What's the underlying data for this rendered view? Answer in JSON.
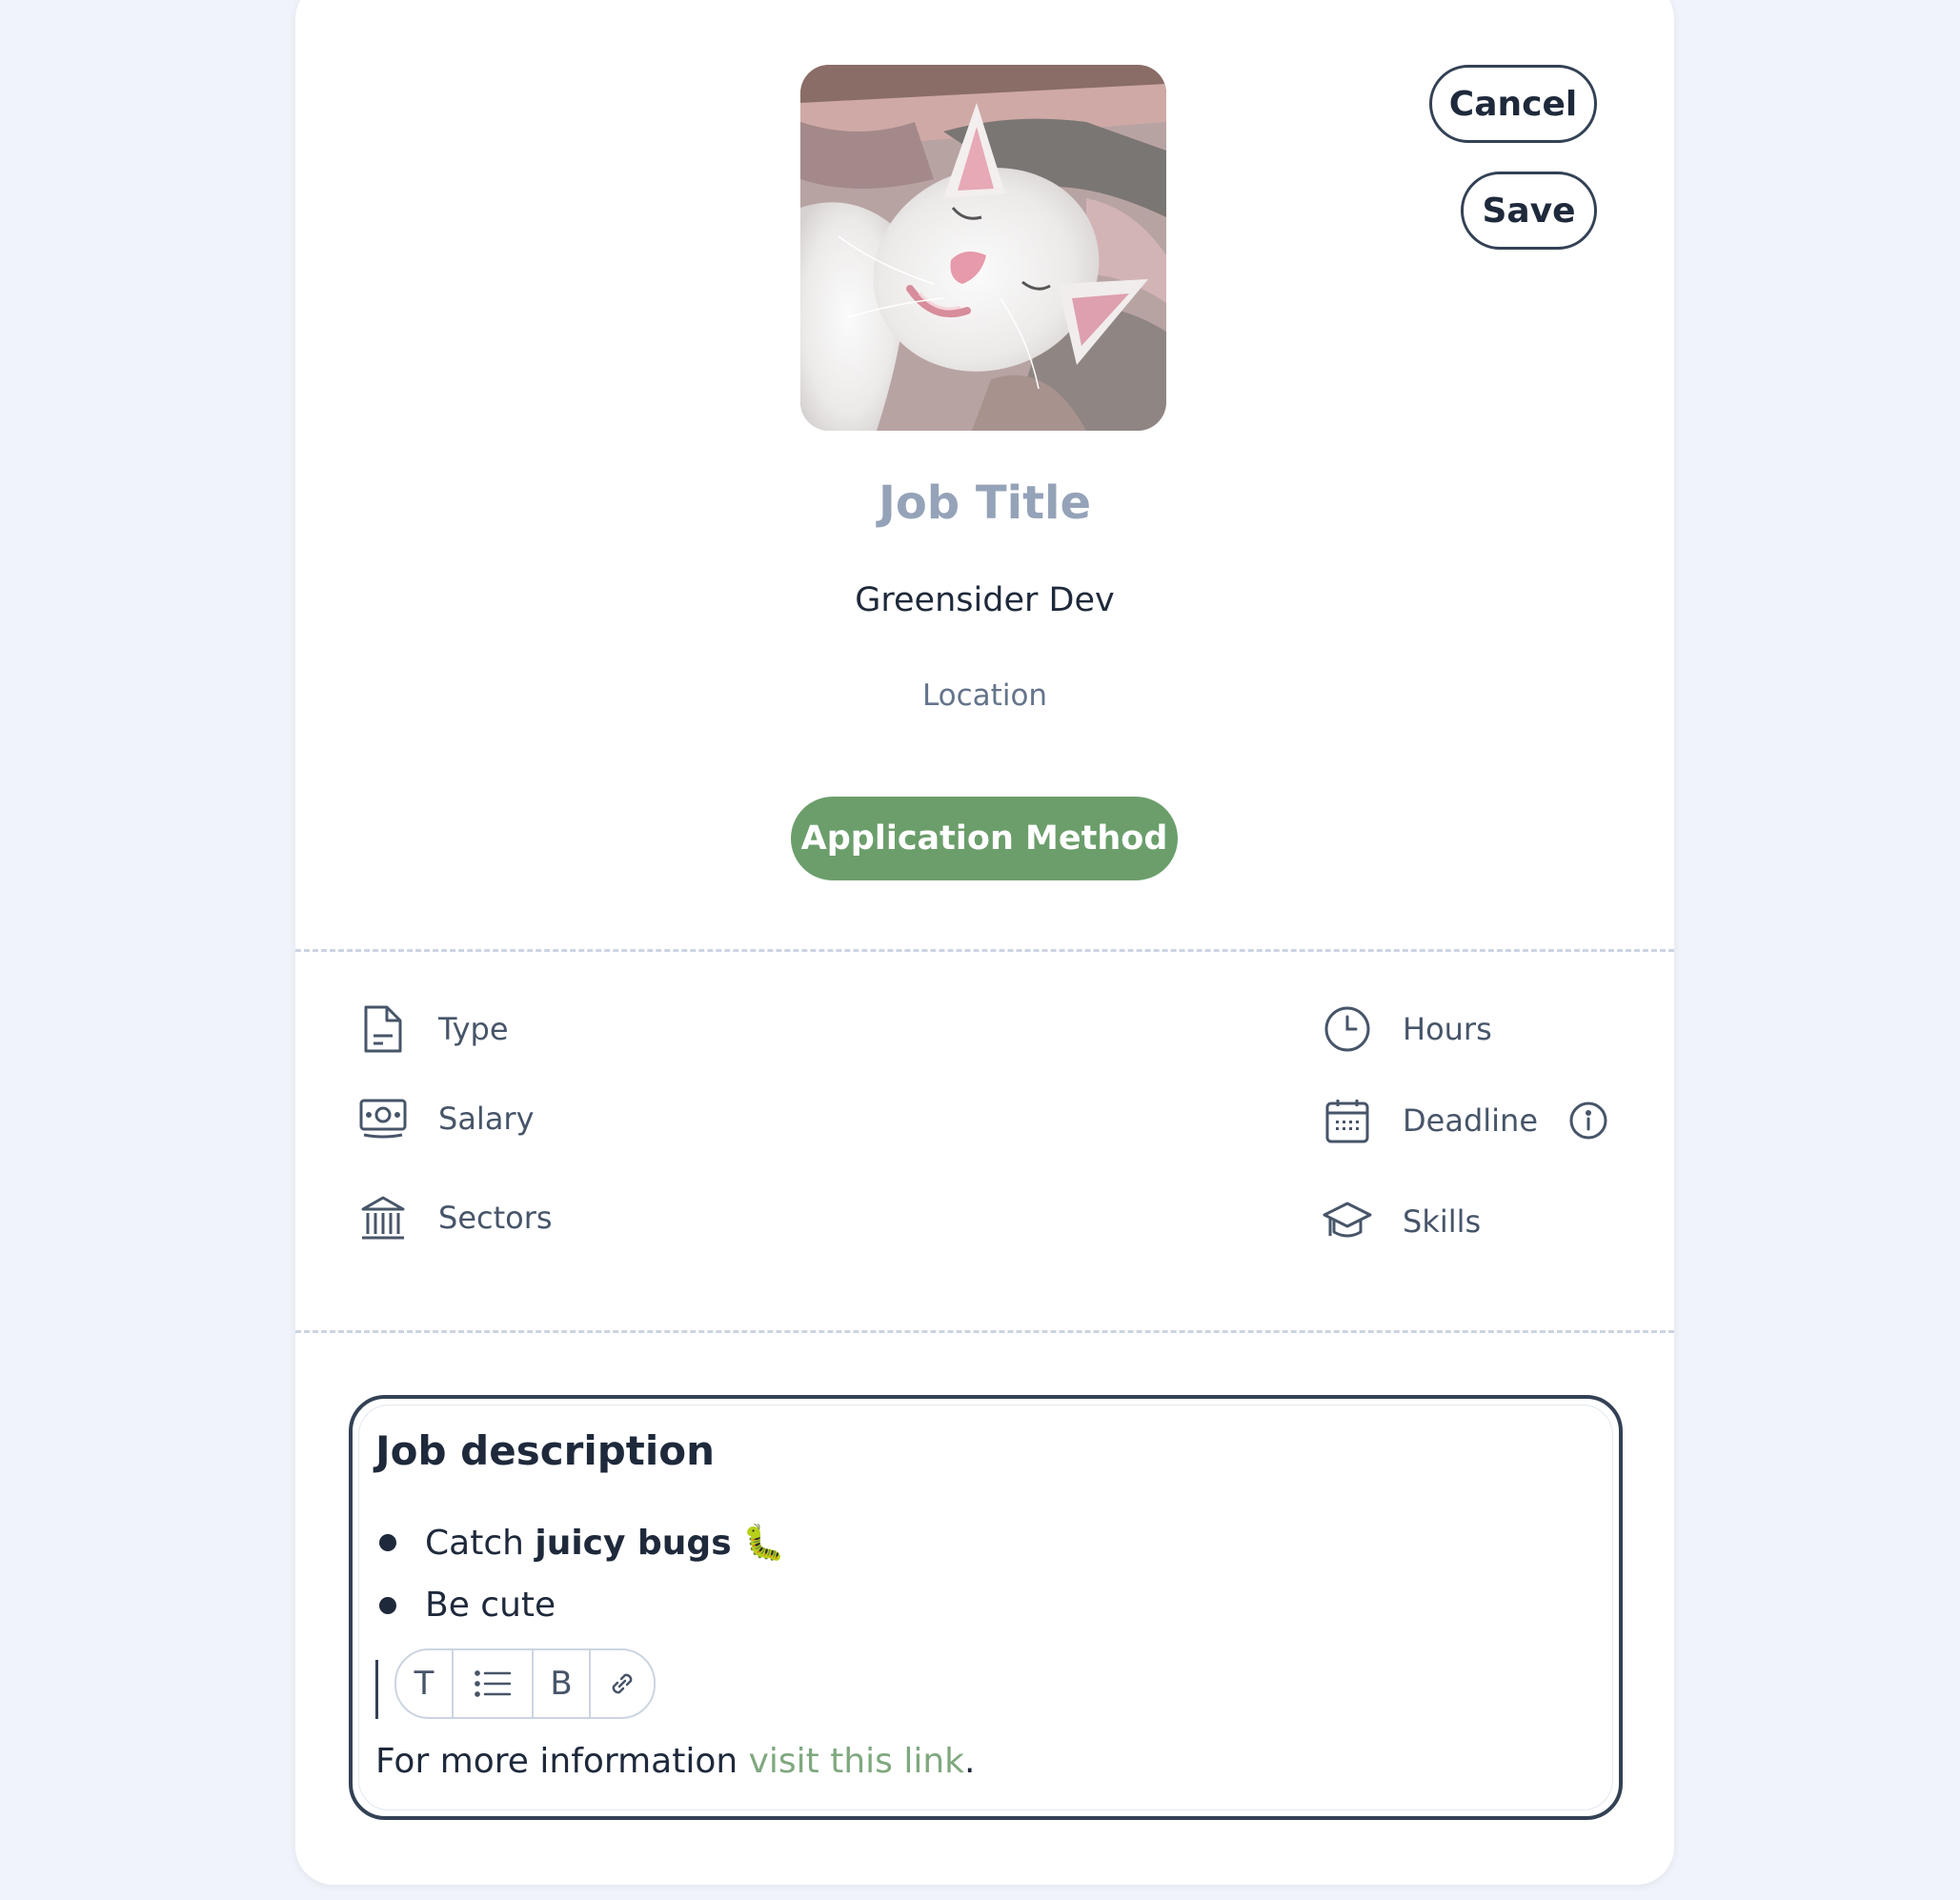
{
  "header": {
    "cancel_label": "Cancel",
    "save_label": "Save"
  },
  "job": {
    "title_placeholder": "Job Title",
    "company": "Greensider Dev",
    "location_placeholder": "Location",
    "apply_label": "Application Method"
  },
  "details": {
    "left": [
      {
        "label": "Type",
        "icon": "document-icon"
      },
      {
        "label": "Salary",
        "icon": "banknote-icon"
      },
      {
        "label": "Sectors",
        "icon": "bank-building-icon"
      }
    ],
    "right": [
      {
        "label": "Hours",
        "icon": "clock-icon"
      },
      {
        "label": "Deadline",
        "icon": "calendar-icon"
      },
      {
        "label": "Skills",
        "icon": "graduation-cap-icon"
      }
    ]
  },
  "description": {
    "heading": "Job description",
    "bullet1_prefix": "Catch ",
    "bullet1_bold": "juicy bugs",
    "bullet1_emoji": "🐛",
    "bullet2": "Be cute",
    "info_text": "For more information ",
    "link_text": "visit this link",
    "info_suffix": "."
  },
  "toolbar": {
    "text_label": "T",
    "bold_label": "B"
  },
  "colors": {
    "background": "#f0f3fa",
    "accent_green": "#6b9e6b",
    "link_green": "#7fa87f",
    "text_dark": "#1e293b",
    "muted": "#94a3b8"
  }
}
